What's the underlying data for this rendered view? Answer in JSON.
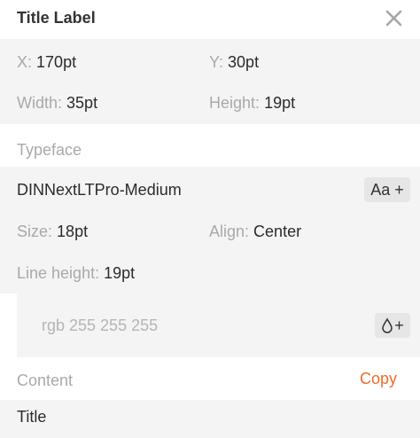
{
  "header": {
    "title": "Title Label",
    "close_icon": "close-icon"
  },
  "geometry": {
    "x_label": "X:",
    "x_value": "170pt",
    "y_label": "Y:",
    "y_value": "30pt",
    "width_label": "Width:",
    "width_value": "35pt",
    "height_label": "Height:",
    "height_value": "19pt"
  },
  "typeface": {
    "section_label": "Typeface",
    "font_name": "DINNextLTPro-Medium",
    "font_button_label": "Aa +",
    "size_label": "Size:",
    "size_value": "18pt",
    "align_label": "Align:",
    "align_value": "Center",
    "line_height_label": "Line height:",
    "line_height_value": "19pt"
  },
  "color": {
    "value": "rgb 255 255 255",
    "add_button_label": "+",
    "drop_icon": "drop-icon"
  },
  "content": {
    "section_label": "Content",
    "copy_label": "Copy",
    "text": "Title"
  },
  "colors": {
    "accent": "#ee6b2a",
    "section_bg": "#f4f4f4",
    "label_gray": "#a9a9a9",
    "text": "#2b2b2b"
  }
}
